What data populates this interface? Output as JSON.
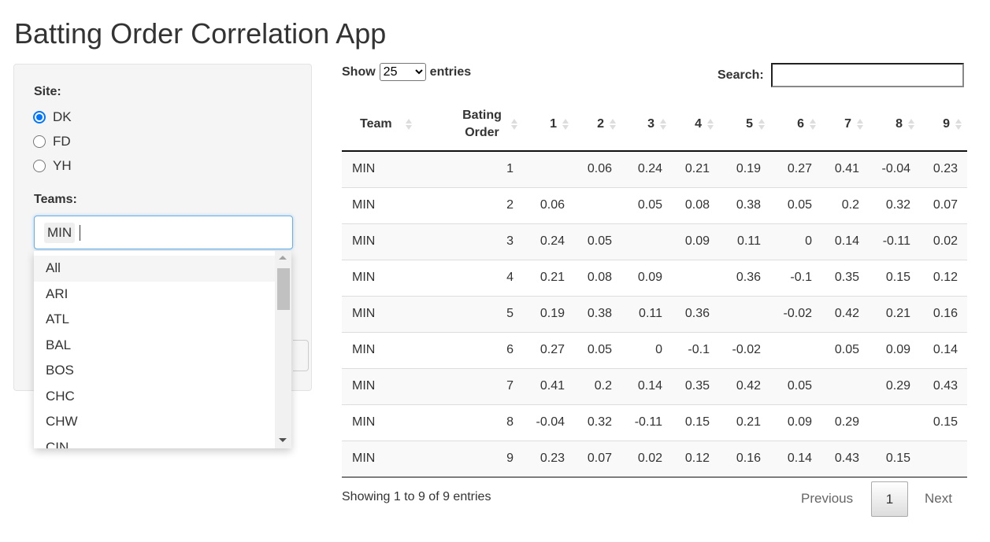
{
  "title": "Batting Order Correlation App",
  "sidebar": {
    "site_label": "Site:",
    "site_options": [
      {
        "label": "DK",
        "checked": true
      },
      {
        "label": "FD",
        "checked": false
      },
      {
        "label": "YH",
        "checked": false
      }
    ],
    "teams_label": "Teams:",
    "teams_selected": "MIN",
    "dropdown": [
      "All",
      "ARI",
      "ATL",
      "BAL",
      "BOS",
      "CHC",
      "CHW",
      "CIN"
    ]
  },
  "table": {
    "show": "Show",
    "length": "25",
    "entries": "entries",
    "search_label": "Search:",
    "search_value": "",
    "headers": [
      "Team",
      "Bating Order",
      "1",
      "2",
      "3",
      "4",
      "5",
      "6",
      "7",
      "8",
      "9"
    ],
    "rows": [
      [
        "MIN",
        "1",
        "",
        "0.06",
        "0.24",
        "0.21",
        "0.19",
        "0.27",
        "0.41",
        "-0.04",
        "0.23"
      ],
      [
        "MIN",
        "2",
        "0.06",
        "",
        "0.05",
        "0.08",
        "0.38",
        "0.05",
        "0.2",
        "0.32",
        "0.07"
      ],
      [
        "MIN",
        "3",
        "0.24",
        "0.05",
        "",
        "0.09",
        "0.11",
        "0",
        "0.14",
        "-0.11",
        "0.02"
      ],
      [
        "MIN",
        "4",
        "0.21",
        "0.08",
        "0.09",
        "",
        "0.36",
        "-0.1",
        "0.35",
        "0.15",
        "0.12"
      ],
      [
        "MIN",
        "5",
        "0.19",
        "0.38",
        "0.11",
        "0.36",
        "",
        "-0.02",
        "0.42",
        "0.21",
        "0.16"
      ],
      [
        "MIN",
        "6",
        "0.27",
        "0.05",
        "0",
        "-0.1",
        "-0.02",
        "",
        "0.05",
        "0.09",
        "0.14"
      ],
      [
        "MIN",
        "7",
        "0.41",
        "0.2",
        "0.14",
        "0.35",
        "0.42",
        "0.05",
        "",
        "0.29",
        "0.43"
      ],
      [
        "MIN",
        "8",
        "-0.04",
        "0.32",
        "-0.11",
        "0.15",
        "0.21",
        "0.09",
        "0.29",
        "",
        "0.15"
      ],
      [
        "MIN",
        "9",
        "0.23",
        "0.07",
        "0.02",
        "0.12",
        "0.16",
        "0.14",
        "0.43",
        "0.15",
        ""
      ]
    ],
    "info": "Showing 1 to 9 of 9 entries",
    "previous": "Previous",
    "page": "1",
    "next": "Next"
  }
}
